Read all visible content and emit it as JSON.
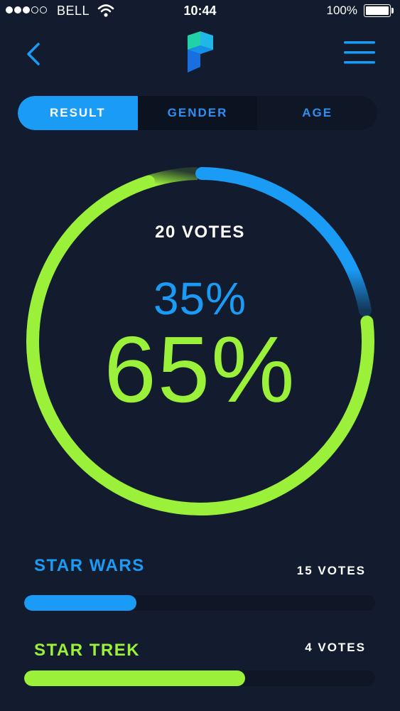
{
  "status_bar": {
    "carrier": "BELL",
    "time": "10:44",
    "battery": "100%"
  },
  "tabs": [
    {
      "label": "RESULT"
    },
    {
      "label": "GENDER"
    },
    {
      "label": "AGE"
    }
  ],
  "poll": {
    "total_votes": "20 VOTES",
    "percent_blue": "35%",
    "percent_green": "65%",
    "share_blue": 0.35,
    "share_green": 0.65
  },
  "results": [
    {
      "name": "STAR WARS",
      "votes": "15 VOTES",
      "fill": 0.32
    },
    {
      "name": "STAR TREK",
      "votes": "4 VOTES",
      "fill": 0.63
    }
  ],
  "colors": {
    "background": "#131c2e",
    "blue": "#1a9cf6",
    "green": "#9bf13a"
  }
}
